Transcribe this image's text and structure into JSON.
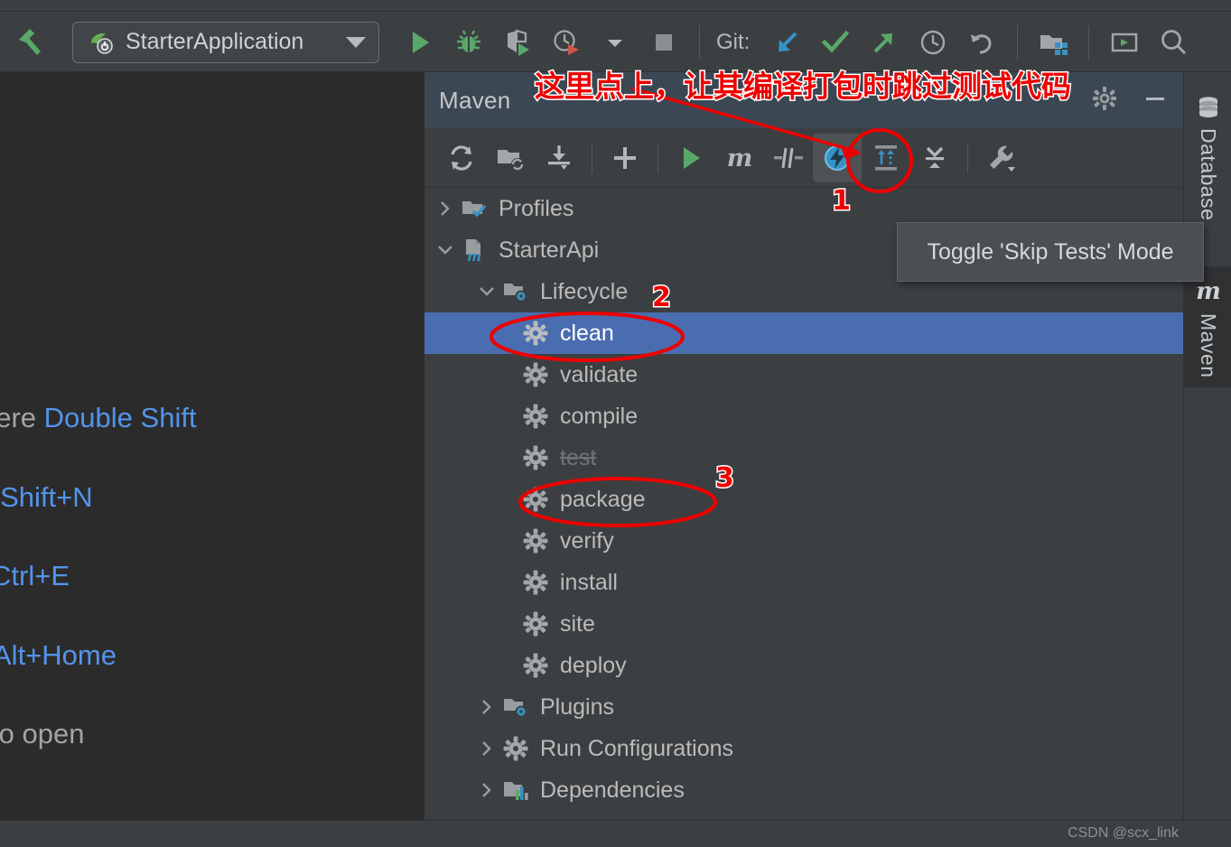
{
  "window": {
    "ghost_title": "",
    "watermark": "CSDN @scx_link"
  },
  "toolbar": {
    "build_icon": "hammer-icon",
    "run_config": {
      "label": "StarterApplication",
      "icon": "spring-boot-icon",
      "dropdown_icon": "chevron-down-icon"
    },
    "buttons": [
      {
        "name": "run-button",
        "icon": "play-icon"
      },
      {
        "name": "debug-button",
        "icon": "bug-icon"
      },
      {
        "name": "run-with-coverage-button",
        "icon": "coverage-icon"
      },
      {
        "name": "profile-button",
        "icon": "profiler-icon"
      },
      {
        "name": "profile-dropdown",
        "icon": "chevron-down-icon"
      },
      {
        "name": "stop-button",
        "icon": "stop-square-icon"
      }
    ],
    "git_label": "Git:",
    "git_buttons": [
      {
        "name": "git-update-button",
        "icon": "arrow-down-left-icon"
      },
      {
        "name": "git-commit-button",
        "icon": "checkmark-icon"
      },
      {
        "name": "git-push-button",
        "icon": "arrow-up-right-icon"
      },
      {
        "name": "git-history-button",
        "icon": "clock-icon"
      },
      {
        "name": "git-rollback-button",
        "icon": "undo-arrow-icon"
      }
    ],
    "right_buttons": [
      {
        "name": "project-structure-button",
        "icon": "folder-modules-icon"
      },
      {
        "name": "terminal-button",
        "icon": "terminal-window-icon"
      },
      {
        "name": "search-everywhere-button",
        "icon": "search-icon"
      }
    ]
  },
  "editor_hints": [
    {
      "prefix": "here",
      "key": "Double Shift"
    },
    {
      "prefix": "",
      "key": "+Shift+N"
    },
    {
      "prefix": "",
      "key": "Ctrl+E"
    },
    {
      "prefix": "",
      "key": "Alt+Home"
    },
    {
      "prefix": "to open",
      "key": ""
    }
  ],
  "maven_panel": {
    "title": "Maven",
    "header_buttons": [
      {
        "name": "settings-button",
        "icon": "gear-icon"
      },
      {
        "name": "minimize-button",
        "icon": "minimize-icon"
      }
    ],
    "toolbar": [
      {
        "name": "reload-project-button",
        "icon": "reload-icon",
        "active": false
      },
      {
        "name": "add-maven-projects-button",
        "icon": "folder-reload-icon",
        "active": false
      },
      {
        "name": "download-sources-button",
        "icon": "download-icon",
        "active": false
      },
      {
        "name": "add-button",
        "icon": "plus-icon",
        "active": false
      },
      {
        "name": "run-maven-build-button",
        "icon": "play-icon",
        "active": false
      },
      {
        "name": "execute-maven-goal-button",
        "icon": "m-letter-icon",
        "active": false
      },
      {
        "name": "toggle-offline-mode-button",
        "icon": "offline-icon",
        "active": false
      },
      {
        "name": "toggle-skip-tests-button",
        "icon": "skip-tests-lightning-icon",
        "active": true
      },
      {
        "name": "expand-all-button",
        "icon": "expand-all-icon",
        "active": false
      },
      {
        "name": "collapse-all-button",
        "icon": "collapse-all-icon",
        "active": false
      },
      {
        "name": "maven-settings-button",
        "icon": "wrench-icon",
        "active": false
      }
    ],
    "tooltip": "Toggle 'Skip Tests' Mode",
    "tree": [
      {
        "label": "Profiles",
        "icon": "folder-check-icon",
        "chevron": "right",
        "indent": 0,
        "state": "normal"
      },
      {
        "label": "StarterApi",
        "icon": "maven-module-icon",
        "chevron": "down",
        "indent": 0,
        "state": "normal"
      },
      {
        "label": "Lifecycle",
        "icon": "folder-gear-icon",
        "chevron": "down",
        "indent": 1,
        "state": "normal"
      },
      {
        "label": "clean",
        "icon": "gear-icon",
        "chevron": "none",
        "indent": 2,
        "state": "selected"
      },
      {
        "label": "validate",
        "icon": "gear-icon",
        "chevron": "none",
        "indent": 2,
        "state": "normal"
      },
      {
        "label": "compile",
        "icon": "gear-icon",
        "chevron": "none",
        "indent": 2,
        "state": "normal"
      },
      {
        "label": "test",
        "icon": "gear-icon",
        "chevron": "none",
        "indent": 2,
        "state": "struck"
      },
      {
        "label": "package",
        "icon": "gear-icon",
        "chevron": "none",
        "indent": 2,
        "state": "normal"
      },
      {
        "label": "verify",
        "icon": "gear-icon",
        "chevron": "none",
        "indent": 2,
        "state": "normal"
      },
      {
        "label": "install",
        "icon": "gear-icon",
        "chevron": "none",
        "indent": 2,
        "state": "normal"
      },
      {
        "label": "site",
        "icon": "gear-icon",
        "chevron": "none",
        "indent": 2,
        "state": "normal"
      },
      {
        "label": "deploy",
        "icon": "gear-icon",
        "chevron": "none",
        "indent": 2,
        "state": "normal"
      },
      {
        "label": "Plugins",
        "icon": "folder-gear-icon",
        "chevron": "right",
        "indent": 1,
        "state": "normal"
      },
      {
        "label": "Run Configurations",
        "icon": "gear-icon",
        "chevron": "right",
        "indent": 1,
        "state": "normal"
      },
      {
        "label": "Dependencies",
        "icon": "dependencies-icon",
        "chevron": "right",
        "indent": 1,
        "state": "normal"
      }
    ]
  },
  "tool_window_bar": [
    {
      "label": "Database",
      "icon": "database-icon",
      "selected": false
    },
    {
      "label": "Maven",
      "icon": "m-letter-icon",
      "selected": true
    }
  ],
  "annotations": {
    "callout_text": "这里点上，让其编译打包时跳过测试代码",
    "markers": [
      {
        "number": "1",
        "target": "toggle-skip-tests-button"
      },
      {
        "number": "2",
        "target": "clean-goal"
      },
      {
        "number": "3",
        "target": "package-goal"
      }
    ],
    "color": "#ee0000"
  },
  "colors": {
    "selection_blue": "#4a6db0",
    "panel_bg": "#3c3f41",
    "editor_bg": "#2b2b2b",
    "header_bg": "#3c4754",
    "accent_blue": "#3592c4",
    "green": "#59a869"
  }
}
